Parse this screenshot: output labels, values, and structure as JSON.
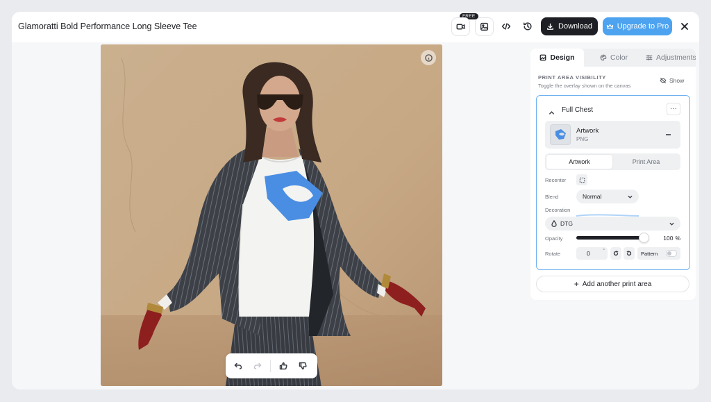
{
  "header": {
    "title": "Glamoratti Bold Performance Long Sleeve Tee",
    "free_badge": "FREE",
    "download_label": "Download",
    "upgrade_label": "Upgrade to Pro"
  },
  "panel": {
    "tabs": [
      {
        "label": "Design",
        "icon": "image-icon",
        "active": true
      },
      {
        "label": "Color",
        "icon": "palette-icon",
        "active": false
      },
      {
        "label": "Adjustments",
        "icon": "sliders-icon",
        "active": false
      }
    ],
    "print_area_visibility": {
      "title": "PRINT AREA VISIBILITY",
      "subtitle": "Toggle the overlay shown on the canvas",
      "show_label": "Show"
    },
    "print_area": {
      "title": "Full Chest",
      "artwork": {
        "name": "Artwork",
        "type": "PNG"
      },
      "segments": [
        "Artwork",
        "Print Area"
      ],
      "active_segment": "Artwork",
      "recenter_label": "Recenter",
      "blend_label": "Blend",
      "blend_value": "Normal",
      "decoration_label": "Decoration",
      "decoration_value": "DTG",
      "opacity_label": "Opacity",
      "opacity_value": "100",
      "opacity_unit": "%",
      "rotate_label": "Rotate",
      "rotate_value": "0",
      "rotate_unit": "°",
      "pattern_label": "Pattern",
      "pattern_enabled": false
    },
    "add_area_label": "Add another print area"
  },
  "colors": {
    "accent": "#4da3ef",
    "dark": "#1d1f24",
    "selection_border": "#6fb2ef",
    "logo_blue": "#4a8ee3"
  }
}
